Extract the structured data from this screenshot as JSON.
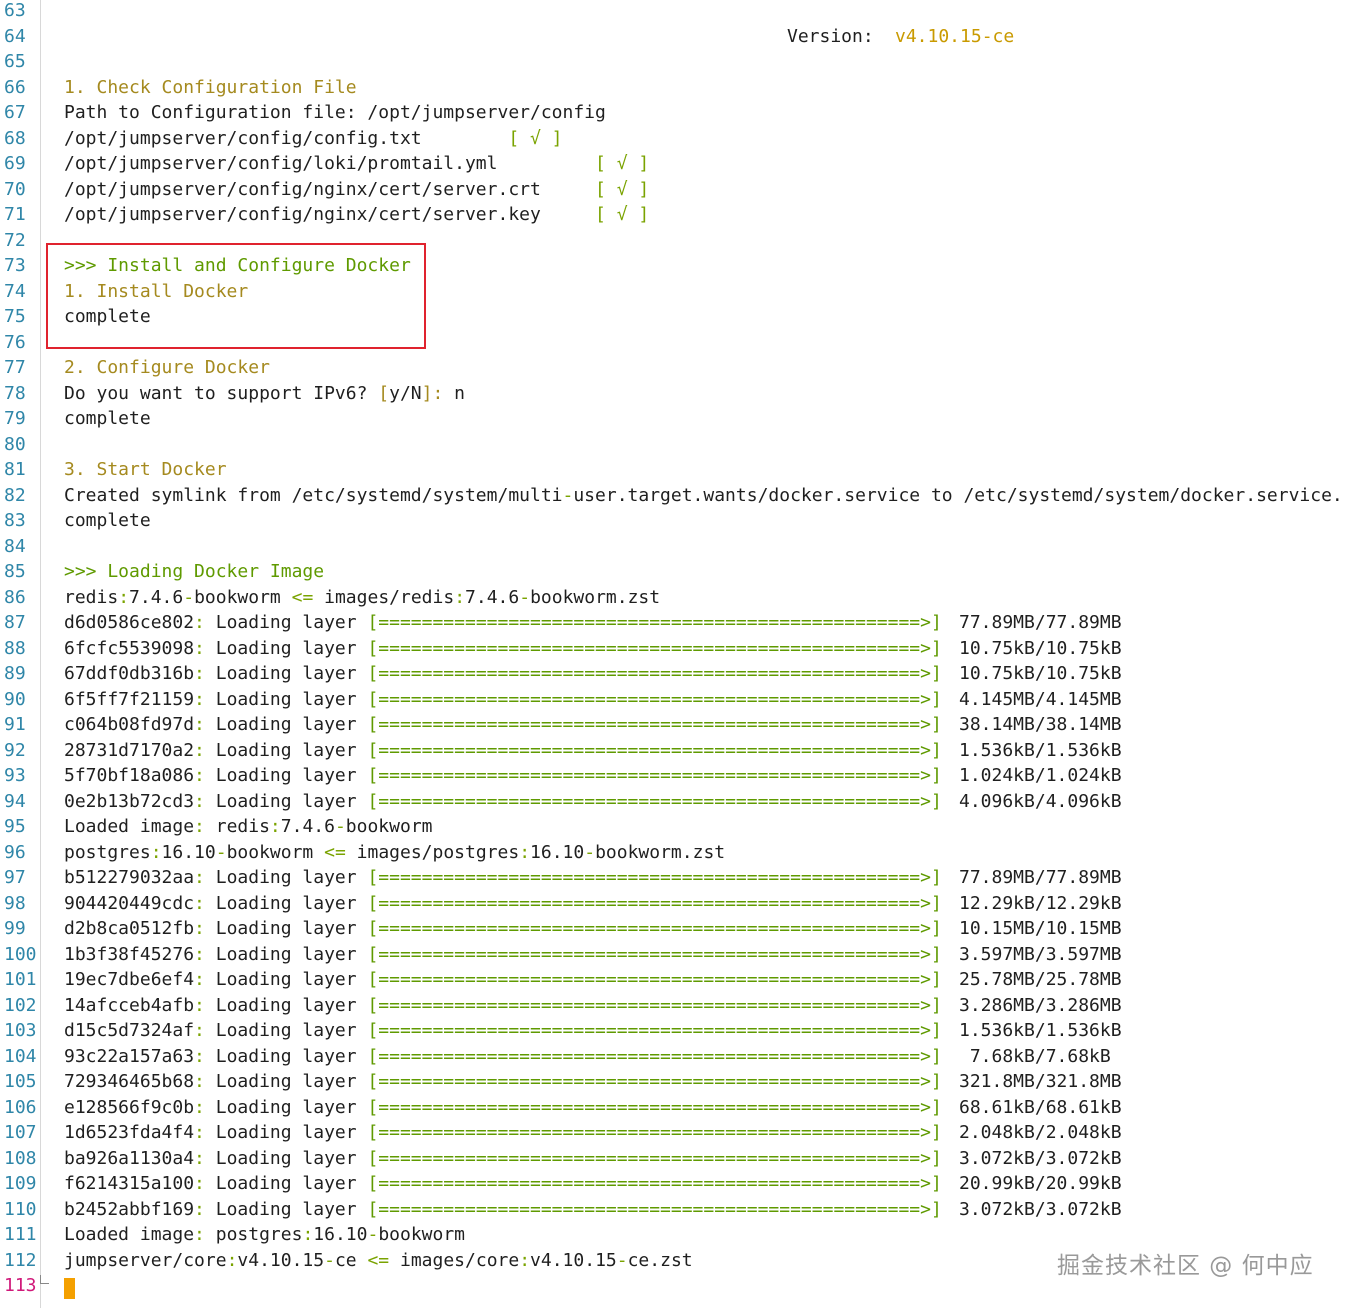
{
  "terminal": {
    "version_label": "Version:",
    "version_value": "v4.10.15-ce",
    "watermark": "掘金技术社区 @ 何中应",
    "lines": [
      {
        "n": "63",
        "segs": []
      },
      {
        "n": "64",
        "segs": []
      },
      {
        "n": "65",
        "segs": []
      },
      {
        "n": "66",
        "segs": [
          {
            "c": "step",
            "t": "1. Check Configuration File"
          }
        ]
      },
      {
        "n": "67",
        "segs": [
          {
            "c": "plain",
            "t": "Path to Configuration file: /opt/jumpserver/config"
          }
        ]
      },
      {
        "n": "68",
        "segs": [
          {
            "c": "plain",
            "t": "/opt/jumpserver/config/config.txt        "
          },
          {
            "c": "check",
            "t": "[ √ ]"
          }
        ]
      },
      {
        "n": "69",
        "segs": [
          {
            "c": "plain",
            "t": "/opt/jumpserver/config/loki/promtail.yml         "
          },
          {
            "c": "check",
            "t": "[ √ ]"
          }
        ]
      },
      {
        "n": "70",
        "segs": [
          {
            "c": "plain",
            "t": "/opt/jumpserver/config/nginx/cert/server.crt     "
          },
          {
            "c": "check",
            "t": "[ √ ]"
          }
        ]
      },
      {
        "n": "71",
        "segs": [
          {
            "c": "plain",
            "t": "/opt/jumpserver/config/nginx/cert/server.key     "
          },
          {
            "c": "check",
            "t": "[ √ ]"
          }
        ]
      },
      {
        "n": "72",
        "segs": []
      },
      {
        "n": "73",
        "segs": [
          {
            "c": "heading",
            "t": ">>> Install and Configure Docker"
          }
        ]
      },
      {
        "n": "74",
        "segs": [
          {
            "c": "step",
            "t": "1. Install Docker"
          }
        ]
      },
      {
        "n": "75",
        "segs": [
          {
            "c": "plain",
            "t": "complete"
          }
        ]
      },
      {
        "n": "76",
        "segs": []
      },
      {
        "n": "77",
        "segs": [
          {
            "c": "step",
            "t": "2. Configure Docker"
          }
        ]
      },
      {
        "n": "78",
        "segs": [
          {
            "c": "plain",
            "t": "Do you want to support IPv6? "
          },
          {
            "c": "step",
            "t": "["
          },
          {
            "c": "plain",
            "t": "y/N"
          },
          {
            "c": "step",
            "t": "]:"
          },
          {
            "c": "plain",
            "t": " n"
          }
        ]
      },
      {
        "n": "79",
        "segs": [
          {
            "c": "plain",
            "t": "complete"
          }
        ]
      },
      {
        "n": "80",
        "segs": []
      },
      {
        "n": "81",
        "segs": [
          {
            "c": "step",
            "t": "3. Start Docker"
          }
        ]
      },
      {
        "n": "82",
        "segs": [
          {
            "c": "plain",
            "t": "Created symlink from /etc/systemd/system/multi"
          },
          {
            "c": "sep",
            "t": "-"
          },
          {
            "c": "plain",
            "t": "user.target.wants/docker.service to /etc/systemd/system/docker.service."
          }
        ]
      },
      {
        "n": "83",
        "segs": [
          {
            "c": "plain",
            "t": "complete"
          }
        ]
      },
      {
        "n": "84",
        "segs": []
      },
      {
        "n": "85",
        "segs": [
          {
            "c": "heading",
            "t": ">>> Loading Docker Image"
          }
        ]
      },
      {
        "n": "86",
        "segs": [
          {
            "c": "plain",
            "t": "redis"
          },
          {
            "c": "sep",
            "t": ":"
          },
          {
            "c": "plain",
            "t": "7.4.6"
          },
          {
            "c": "sep",
            "t": "-"
          },
          {
            "c": "plain",
            "t": "bookworm "
          },
          {
            "c": "sep",
            "t": "<="
          },
          {
            "c": "plain",
            "t": " images/redis"
          },
          {
            "c": "sep",
            "t": ":"
          },
          {
            "c": "plain",
            "t": "7.4.6"
          },
          {
            "c": "sep",
            "t": "-"
          },
          {
            "c": "plain",
            "t": "bookworm.zst"
          }
        ]
      },
      {
        "n": "87",
        "layer": "d6d0586ce802",
        "size": "77.89MB/77.89MB"
      },
      {
        "n": "88",
        "layer": "6fcfc5539098",
        "size": "10.75kB/10.75kB"
      },
      {
        "n": "89",
        "layer": "67ddf0db316b",
        "size": "10.75kB/10.75kB"
      },
      {
        "n": "90",
        "layer": "6f5ff7f21159",
        "size": "4.145MB/4.145MB"
      },
      {
        "n": "91",
        "layer": "c064b08fd97d",
        "size": "38.14MB/38.14MB"
      },
      {
        "n": "92",
        "layer": "28731d7170a2",
        "size": "1.536kB/1.536kB"
      },
      {
        "n": "93",
        "layer": "5f70bf18a086",
        "size": "1.024kB/1.024kB"
      },
      {
        "n": "94",
        "layer": "0e2b13b72cd3",
        "size": "4.096kB/4.096kB"
      },
      {
        "n": "95",
        "segs": [
          {
            "c": "plain",
            "t": "Loaded image"
          },
          {
            "c": "sep",
            "t": ":"
          },
          {
            "c": "plain",
            "t": " redis"
          },
          {
            "c": "sep",
            "t": ":"
          },
          {
            "c": "plain",
            "t": "7.4.6"
          },
          {
            "c": "sep",
            "t": "-"
          },
          {
            "c": "plain",
            "t": "bookworm"
          }
        ]
      },
      {
        "n": "96",
        "segs": [
          {
            "c": "plain",
            "t": "postgres"
          },
          {
            "c": "sep",
            "t": ":"
          },
          {
            "c": "plain",
            "t": "16.10"
          },
          {
            "c": "sep",
            "t": "-"
          },
          {
            "c": "plain",
            "t": "bookworm "
          },
          {
            "c": "sep",
            "t": "<="
          },
          {
            "c": "plain",
            "t": " images/postgres"
          },
          {
            "c": "sep",
            "t": ":"
          },
          {
            "c": "plain",
            "t": "16.10"
          },
          {
            "c": "sep",
            "t": "-"
          },
          {
            "c": "plain",
            "t": "bookworm.zst"
          }
        ]
      },
      {
        "n": "97",
        "layer": "b512279032aa",
        "size": "77.89MB/77.89MB"
      },
      {
        "n": "98",
        "layer": "904420449cdc",
        "size": "12.29kB/12.29kB"
      },
      {
        "n": "99",
        "layer": "d2b8ca0512fb",
        "size": "10.15MB/10.15MB"
      },
      {
        "n": "100",
        "layer": "1b3f38f45276",
        "size": "3.597MB/3.597MB"
      },
      {
        "n": "101",
        "layer": "19ec7dbe6ef4",
        "size": "25.78MB/25.78MB"
      },
      {
        "n": "102",
        "layer": "14afcceb4afb",
        "size": "3.286MB/3.286MB"
      },
      {
        "n": "103",
        "layer": "d15c5d7324af",
        "size": "1.536kB/1.536kB"
      },
      {
        "n": "104",
        "layer": "93c22a157a63",
        "size": " 7.68kB/7.68kB"
      },
      {
        "n": "105",
        "layer": "729346465b68",
        "size": "321.8MB/321.8MB"
      },
      {
        "n": "106",
        "layer": "e128566f9c0b",
        "size": "68.61kB/68.61kB"
      },
      {
        "n": "107",
        "layer": "1d6523fda4f4",
        "size": "2.048kB/2.048kB"
      },
      {
        "n": "108",
        "layer": "ba926a1130a4",
        "size": "3.072kB/3.072kB"
      },
      {
        "n": "109",
        "layer": "f6214315a100",
        "size": "20.99kB/20.99kB"
      },
      {
        "n": "110",
        "layer": "b2452abbf169",
        "size": "3.072kB/3.072kB"
      },
      {
        "n": "111",
        "segs": [
          {
            "c": "plain",
            "t": "Loaded image"
          },
          {
            "c": "sep",
            "t": ":"
          },
          {
            "c": "plain",
            "t": " postgres"
          },
          {
            "c": "sep",
            "t": ":"
          },
          {
            "c": "plain",
            "t": "16.10"
          },
          {
            "c": "sep",
            "t": "-"
          },
          {
            "c": "plain",
            "t": "bookworm"
          }
        ]
      },
      {
        "n": "112",
        "segs": [
          {
            "c": "plain",
            "t": "jumpserver/core"
          },
          {
            "c": "sep",
            "t": ":"
          },
          {
            "c": "plain",
            "t": "v4.10.15"
          },
          {
            "c": "sep",
            "t": "-"
          },
          {
            "c": "plain",
            "t": "ce "
          },
          {
            "c": "sep",
            "t": "<="
          },
          {
            "c": "plain",
            "t": " images/core"
          },
          {
            "c": "sep",
            "t": ":"
          },
          {
            "c": "plain",
            "t": "v4.10.15"
          },
          {
            "c": "sep",
            "t": "-"
          },
          {
            "c": "plain",
            "t": "ce.zst"
          }
        ]
      },
      {
        "n": "113",
        "segs": [],
        "current": true
      }
    ],
    "layer_label": "Loading layer",
    "progress_bar": "[==================================================>]",
    "colors": {
      "line_number": "#2f86a8",
      "current_line_number": "#d0197a",
      "heading": "#5f9a00",
      "step": "#a58a1f",
      "accent": "#c99a00",
      "cursor": "#f4a000",
      "highlight_box": "#e0232e"
    }
  }
}
